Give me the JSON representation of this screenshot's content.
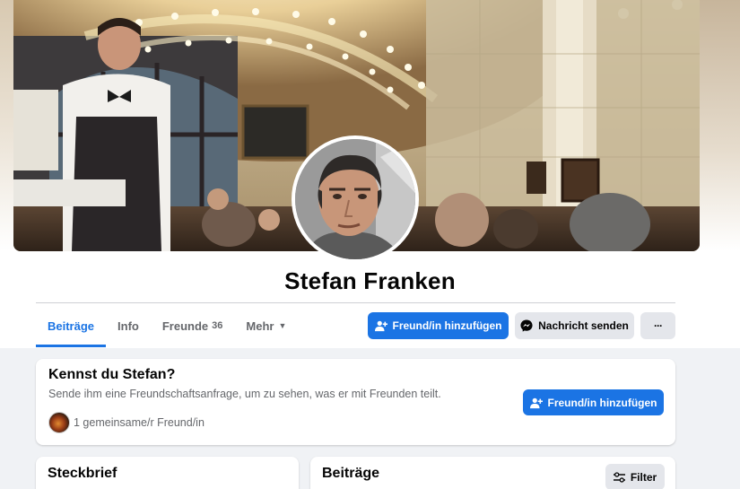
{
  "profile": {
    "name": "Stefan Franken"
  },
  "tabs": [
    {
      "label": "Beiträge",
      "active": true
    },
    {
      "label": "Info"
    },
    {
      "label": "Freunde",
      "count": "36"
    },
    {
      "label": "Mehr"
    }
  ],
  "actions": {
    "add_friend_label": "Freund/in hinzufügen",
    "message_label": "Nachricht senden",
    "more_label": "···"
  },
  "know_card": {
    "title": "Kennst du Stefan?",
    "text": "Sende ihm eine Freundschaftsanfrage, um zu sehen, was er mit Freunden teilt.",
    "mutual": "1 gemeinsame/r Freund/in",
    "button_label": "Freund/in hinzufügen"
  },
  "steckbrief": {
    "title": "Steckbrief"
  },
  "posts": {
    "title": "Beiträge",
    "filter_label": "Filter"
  },
  "icons": {
    "add_friend": "person-plus-icon",
    "message": "messenger-icon",
    "more": "ellipsis-icon",
    "filter": "sliders-icon",
    "dropdown": "caret-down-icon"
  },
  "colors": {
    "accent": "#1b74e4",
    "background": "#f0f2f5",
    "secondary_button": "#e4e6eb",
    "muted_text": "#65676b"
  }
}
